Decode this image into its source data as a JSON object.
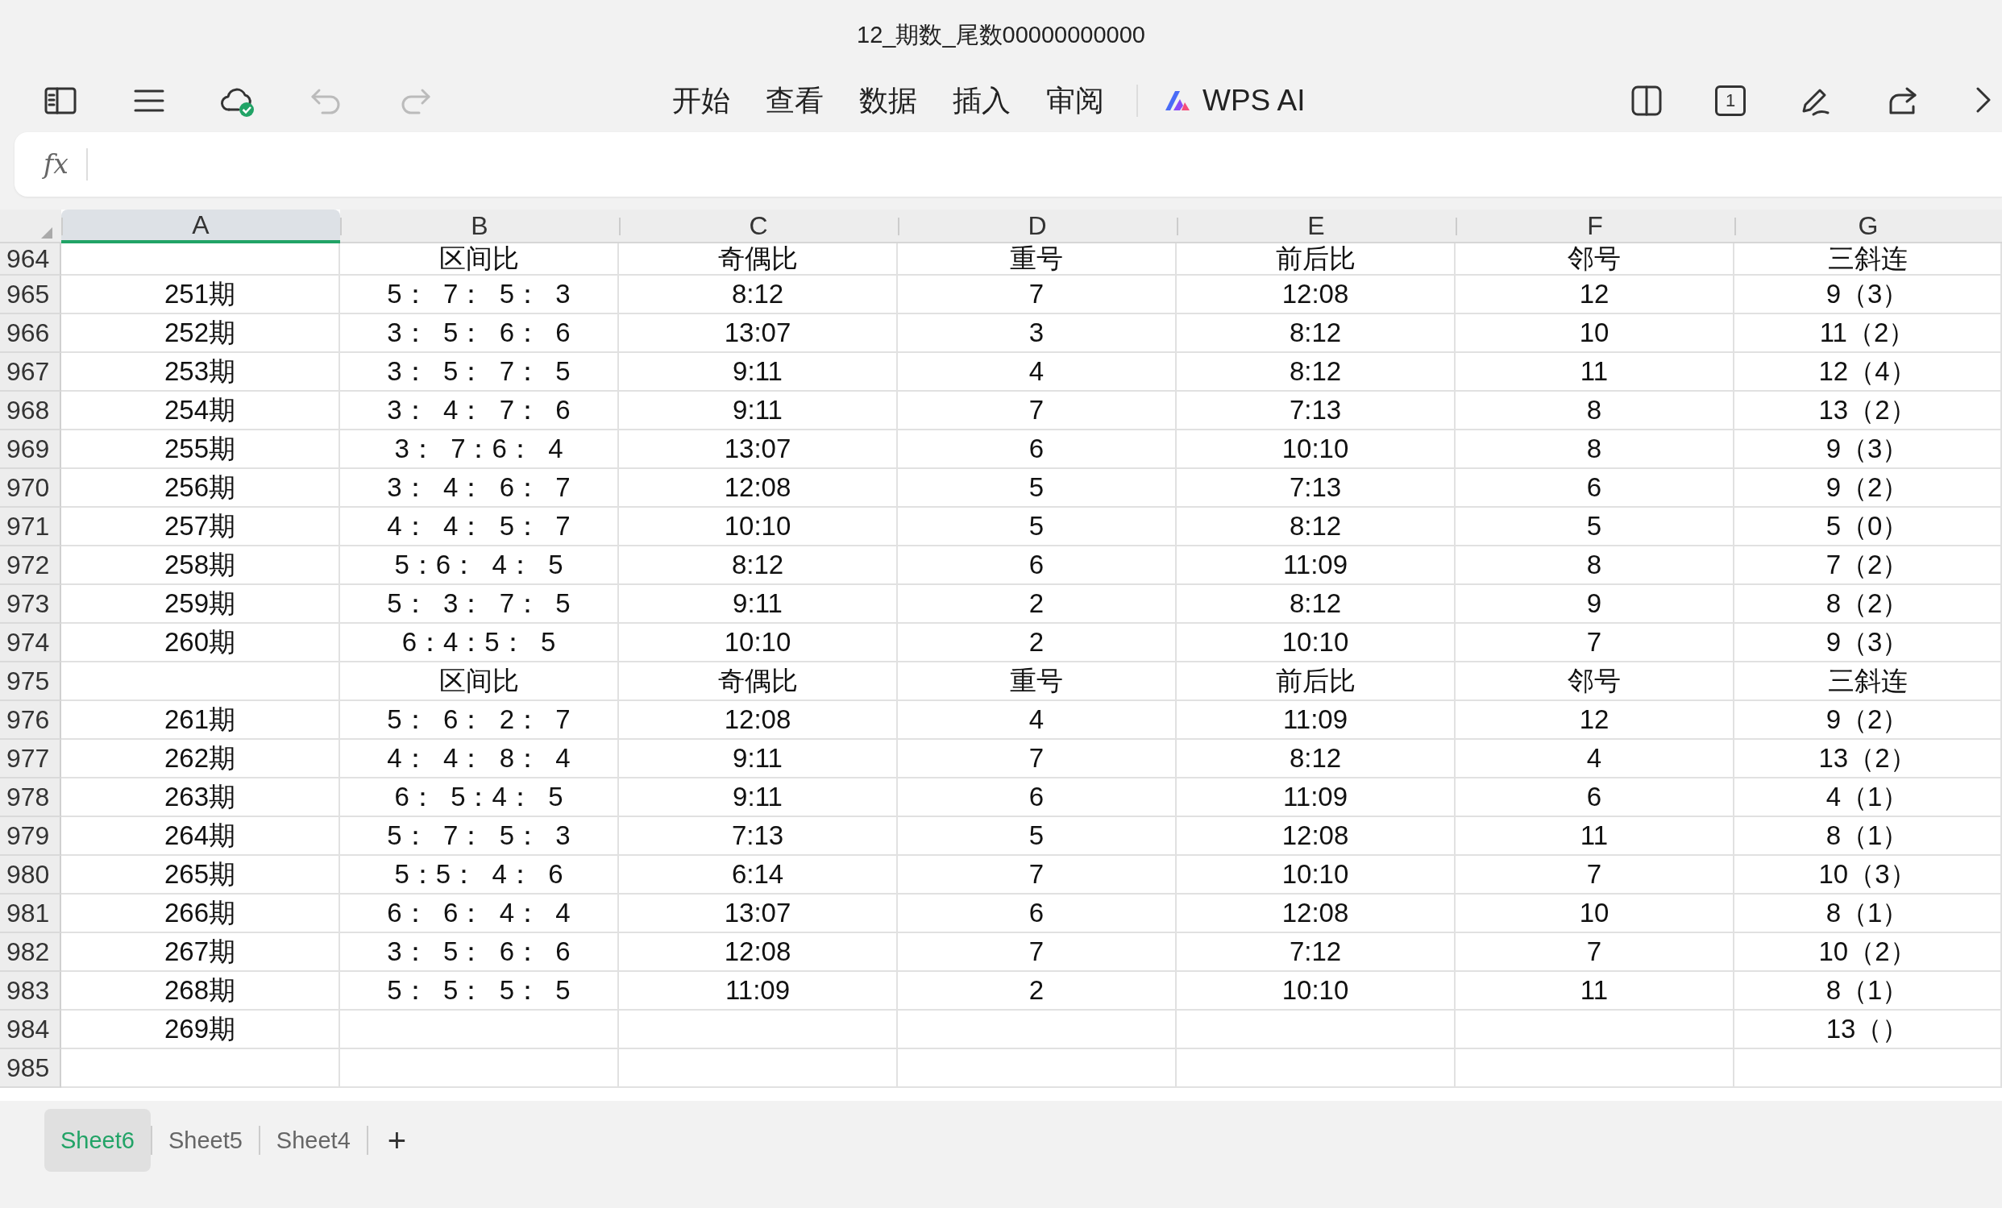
{
  "window": {
    "title": "12_期数_尾数00000000000"
  },
  "toolbar": {
    "menu_tabs": [
      "开始",
      "查看",
      "数据",
      "插入",
      "审阅"
    ],
    "ai_button": "WPS AI",
    "page_indicator": "1"
  },
  "formula_bar": {
    "label": "fx"
  },
  "columns": [
    {
      "label": "A",
      "selected": true
    },
    {
      "label": "B",
      "selected": false
    },
    {
      "label": "C",
      "selected": false
    },
    {
      "label": "D",
      "selected": false
    },
    {
      "label": "E",
      "selected": false
    },
    {
      "label": "F",
      "selected": false
    },
    {
      "label": "G",
      "selected": false
    }
  ],
  "rows": [
    {
      "number": "964",
      "cells": [
        null,
        "区间比",
        "奇偶比",
        "重号",
        "前后比",
        "邻号",
        "三斜连"
      ]
    },
    {
      "number": "965",
      "cells": [
        "251期",
        "5：  7：  5：  3",
        "8:12",
        "7",
        "12:08",
        "12",
        "9（3）"
      ]
    },
    {
      "number": "966",
      "cells": [
        "252期",
        "3：  5：  6：  6",
        "13:07",
        "3",
        "8:12",
        "10",
        "11（2）"
      ]
    },
    {
      "number": "967",
      "cells": [
        "253期",
        "3：  5：  7：  5",
        "9:11",
        "4",
        "8:12",
        "11",
        "12（4）"
      ]
    },
    {
      "number": "968",
      "cells": [
        "254期",
        "3：  4：  7：  6",
        "9:11",
        "7",
        "7:13",
        "8",
        "13（2）"
      ]
    },
    {
      "number": "969",
      "cells": [
        "255期",
        "3：  7：6：  4",
        "13:07",
        "6",
        "10:10",
        "8",
        "9（3）"
      ]
    },
    {
      "number": "970",
      "cells": [
        "256期",
        "3：  4：  6：  7",
        "12:08",
        "5",
        "7:13",
        "6",
        "9（2）"
      ]
    },
    {
      "number": "971",
      "cells": [
        "257期",
        "4：  4：  5：  7",
        "10:10",
        "5",
        "8:12",
        "5",
        "5（0）"
      ]
    },
    {
      "number": "972",
      "cells": [
        "258期",
        "5：6：  4：  5",
        "8:12",
        "6",
        "11:09",
        "8",
        "7（2）"
      ]
    },
    {
      "number": "973",
      "cells": [
        "259期",
        "5：  3：  7：  5",
        "9:11",
        "2",
        "8:12",
        "9",
        "8（2）"
      ]
    },
    {
      "number": "974",
      "cells": [
        "260期",
        "6：4：5：  5",
        "10:10",
        "2",
        "10:10",
        "7",
        "9（3）"
      ]
    },
    {
      "number": "975",
      "cells": [
        null,
        "区间比",
        "奇偶比",
        "重号",
        "前后比",
        "邻号",
        "三斜连"
      ]
    },
    {
      "number": "976",
      "cells": [
        "261期",
        "5：  6：  2：  7",
        "12:08",
        "4",
        "11:09",
        "12",
        "9（2）"
      ]
    },
    {
      "number": "977",
      "cells": [
        "262期",
        "4：  4：  8：  4",
        "9:11",
        "7",
        "8:12",
        "4",
        "13（2）"
      ]
    },
    {
      "number": "978",
      "cells": [
        "263期",
        "6：  5：4：  5",
        "9:11",
        "6",
        "11:09",
        "6",
        "4（1）"
      ]
    },
    {
      "number": "979",
      "cells": [
        "264期",
        "5：  7：  5：  3",
        "7:13",
        "5",
        "12:08",
        "11",
        "8（1）"
      ]
    },
    {
      "number": "980",
      "cells": [
        "265期",
        "5：5：  4：  6",
        "6:14",
        "7",
        "10:10",
        "7",
        "10（3）"
      ]
    },
    {
      "number": "981",
      "cells": [
        "266期",
        "6：  6：  4：  4",
        "13:07",
        "6",
        "12:08",
        "10",
        "8（1）"
      ]
    },
    {
      "number": "982",
      "cells": [
        "267期",
        "3：  5：  6：  6",
        "12:08",
        "7",
        "7:12",
        "7",
        "10（2）"
      ]
    },
    {
      "number": "983",
      "cells": [
        "268期",
        "5：  5：  5：  5",
        "11:09",
        "2",
        "10:10",
        "11",
        "8（1）"
      ]
    },
    {
      "number": "984",
      "cells": [
        "269期",
        null,
        null,
        null,
        null,
        null,
        "13（）"
      ]
    },
    {
      "number": "985",
      "cells": [
        null,
        null,
        null,
        null,
        null,
        null,
        null
      ]
    }
  ],
  "sheet_tabs": [
    {
      "label": "Sheet6",
      "selected": true
    },
    {
      "label": "Sheet5",
      "selected": false
    },
    {
      "label": "Sheet4",
      "selected": false
    }
  ],
  "add_sheet": "+"
}
